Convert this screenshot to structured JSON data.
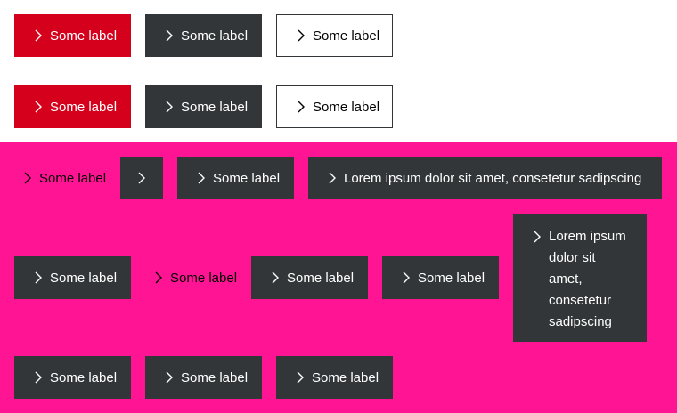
{
  "buttons": {
    "label": "Some label",
    "long_label": "Lorem ipsum dolor sit amet, consetetur sadipscing"
  },
  "icons": {
    "arrow": "arrow-head-right-icon"
  },
  "colors": {
    "primary_red": "#d5001c",
    "dark_grey": "#323639",
    "pink_background": "#ff1493",
    "white": "#ffffff"
  }
}
